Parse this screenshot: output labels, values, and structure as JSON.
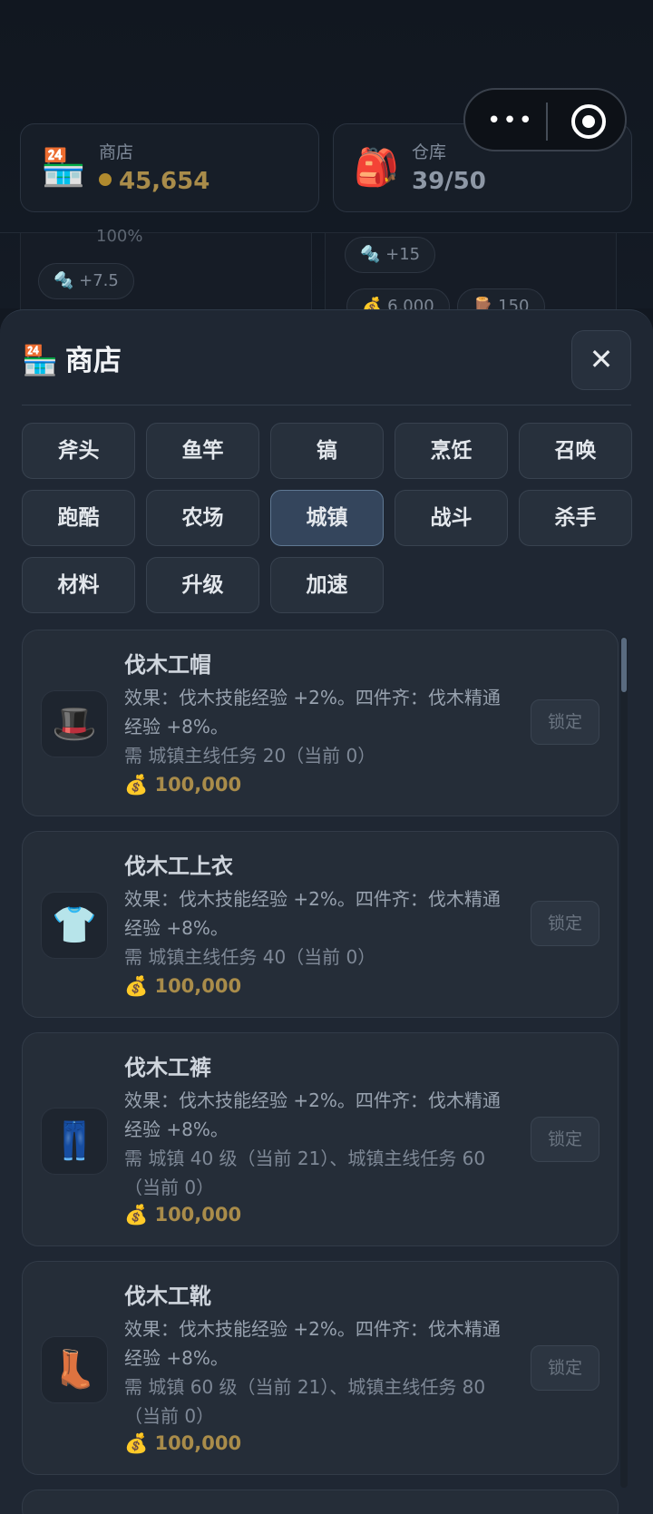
{
  "header": {
    "shop_card": {
      "icon": "🏪",
      "label": "商店",
      "value": "45,654"
    },
    "bag_card": {
      "icon": "🎒",
      "label": "仓库",
      "value": "39/50"
    },
    "capsule": {
      "dots": "•••"
    }
  },
  "background": {
    "percent": "100%",
    "left_pill": "🔩 +7.5",
    "right_pill": "🔩 +15",
    "right_cost1": "💰 6,000",
    "right_cost2": "🪵 150"
  },
  "modal": {
    "title_icon": "🏪",
    "title": "商店",
    "close": "✕",
    "categories": [
      "斧头",
      "鱼竿",
      "镐",
      "烹饪",
      "召唤",
      "跑酷",
      "农场",
      "城镇",
      "战斗",
      "杀手",
      "材料",
      "升级",
      "加速"
    ],
    "active_category": "城镇",
    "items": [
      {
        "icon": "🎩",
        "name": "伐木工帽",
        "desc": "效果：伐木技能经验 +2%。四件齐：伐木精通经验 +8%。",
        "req": "需 城镇主线任务 20（当前 0）",
        "price": "💰 100,000",
        "button": "锁定"
      },
      {
        "icon": "👕",
        "name": "伐木工上衣",
        "desc": "效果：伐木技能经验 +2%。四件齐：伐木精通经验 +8%。",
        "req": "需 城镇主线任务 40（当前 0）",
        "price": "💰 100,000",
        "button": "锁定"
      },
      {
        "icon": "👖",
        "name": "伐木工裤",
        "desc": "效果：伐木技能经验 +2%。四件齐：伐木精通经验 +8%。",
        "req": "需 城镇 40 级（当前 21）、城镇主线任务 60（当前 0）",
        "price": "💰 100,000",
        "button": "锁定"
      },
      {
        "icon": "👢",
        "name": "伐木工靴",
        "desc": "效果：伐木技能经验 +2%。四件齐：伐木精通经验 +8%。",
        "req": "需 城镇 60 级（当前 21）、城镇主线任务 80（当前 0）",
        "price": "💰 100,000",
        "button": "锁定"
      }
    ]
  }
}
